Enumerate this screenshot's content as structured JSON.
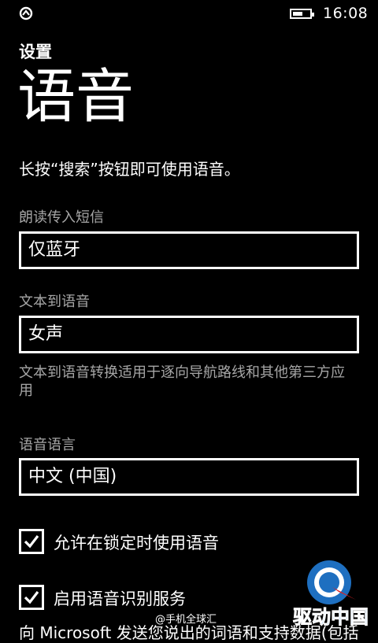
{
  "status": {
    "time": "16:08",
    "battery_level": 0.6,
    "left_icon": "sync-icon"
  },
  "header": {
    "app_title": "设置",
    "page_title": "语音"
  },
  "hint": "长按“搜索”按钮即可使用语音。",
  "settings": {
    "read_sms": {
      "label": "朗读传入短信",
      "value": "仅蓝牙"
    },
    "tts": {
      "label": "文本到语音",
      "value": "女声",
      "description": "文本到语音转换适用于逐向导航路线和其他第三方应用"
    },
    "language": {
      "label": "语音语言",
      "value": "中文 (中国)"
    }
  },
  "checkboxes": [
    {
      "label": "允许在锁定时使用语音",
      "checked": true
    },
    {
      "label": "启用语音识别服务",
      "checked": true
    }
  ],
  "cut_text": "向 Microsoft 发送您说出的词语和支持数据(包括",
  "watermark": {
    "text": "@手机全球汇",
    "logo_text": "驱动中国"
  },
  "colors": {
    "background": "#000000",
    "foreground": "#ffffff",
    "subtle": "#a6a6a6"
  }
}
